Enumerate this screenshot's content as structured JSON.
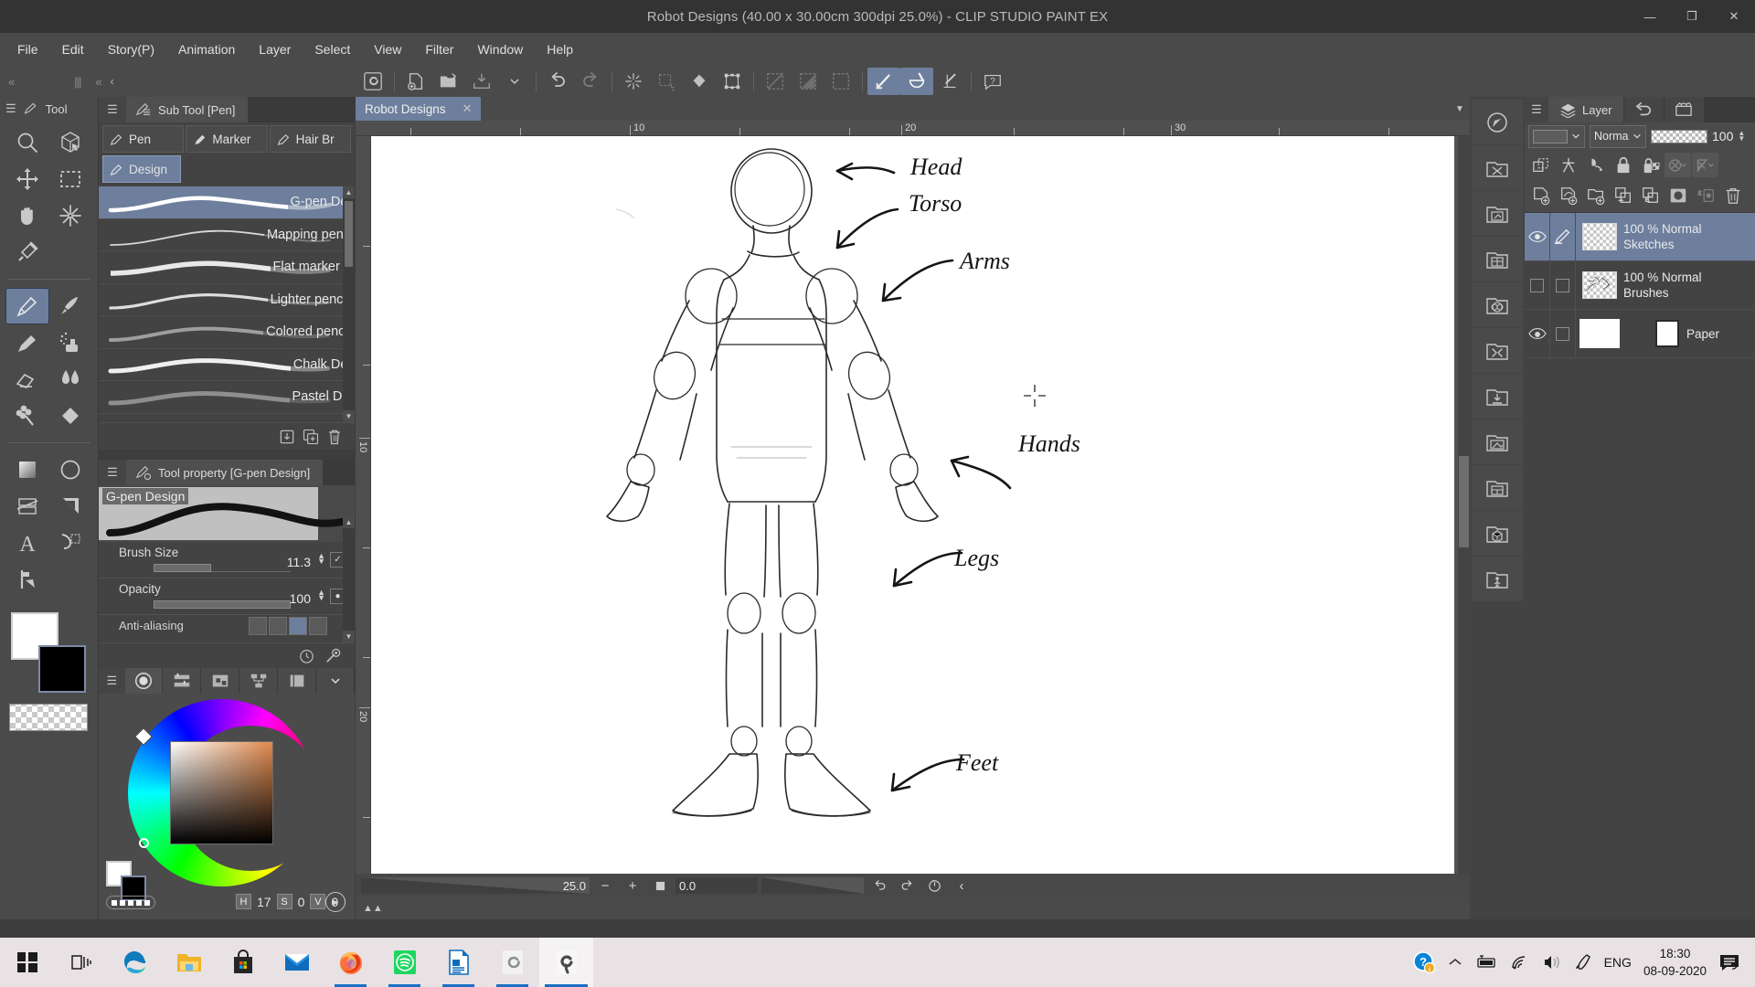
{
  "window": {
    "title": "Robot Designs (40.00 x 30.00cm 300dpi 25.0%)  - CLIP STUDIO PAINT EX",
    "minimize": "—",
    "maximize": "❐",
    "close": "✕"
  },
  "menu": {
    "items": [
      {
        "label": "File"
      },
      {
        "label": "Edit"
      },
      {
        "label": "Story(P)"
      },
      {
        "label": "Animation"
      },
      {
        "label": "Layer"
      },
      {
        "label": "Select"
      },
      {
        "label": "View"
      },
      {
        "label": "Filter"
      },
      {
        "label": "Window"
      },
      {
        "label": "Help"
      }
    ]
  },
  "command_bar": {
    "buttons": [
      {
        "name": "clip-studio-logo-button",
        "icon": "spiral-icon"
      },
      {
        "name": "new-document-button",
        "icon": "new-doc-icon"
      },
      {
        "name": "open-file-button",
        "icon": "open-folder-icon"
      },
      {
        "name": "save-button",
        "icon": "save-icon"
      },
      {
        "name": "save-dropdown-button",
        "icon": "chevron-down-icon"
      },
      {
        "name": "undo-button",
        "icon": "undo-arrow-icon"
      },
      {
        "name": "redo-button",
        "icon": "redo-arrow-icon"
      },
      {
        "name": "clear-button",
        "icon": "sparkle-clear-icon"
      },
      {
        "name": "fill-selection-button",
        "icon": "dashed-fill-icon"
      },
      {
        "name": "fill-button",
        "icon": "paint-drop-icon"
      },
      {
        "name": "transform-button",
        "icon": "transform-box-icon"
      },
      {
        "name": "deselect-button",
        "icon": "deselect-icon"
      },
      {
        "name": "invert-selection-button",
        "icon": "invert-selection-icon"
      },
      {
        "name": "select-all-button",
        "icon": "select-all-icon"
      },
      {
        "name": "snap-ruler-button",
        "icon": "snap-ruler-icon"
      },
      {
        "name": "snap-special-ruler-button",
        "icon": "snap-special-ruler-icon"
      },
      {
        "name": "snap-grid-button",
        "icon": "snap-grid-icon"
      },
      {
        "name": "help-button",
        "icon": "question-balloon-icon"
      }
    ]
  },
  "tool_palette": {
    "title": "Tool",
    "tools": [
      {
        "name": "zoom-tool",
        "icon": "magnifier-icon"
      },
      {
        "name": "rotate-3d-tool",
        "icon": "cube-cursor-icon"
      },
      {
        "name": "move-tool",
        "icon": "four-arrows-icon"
      },
      {
        "name": "operation-tool",
        "icon": "dashed-rect-icon"
      },
      {
        "name": "hand-tool",
        "icon": "hand-icon"
      },
      {
        "name": "auto-select-tool",
        "icon": "magic-wand-star-icon"
      },
      {
        "name": "eyedropper-tool",
        "icon": "eyedropper-icon"
      },
      {
        "name": "pen-tool",
        "icon": "pen-nib-icon"
      },
      {
        "name": "brush-tool",
        "icon": "brush-icon"
      },
      {
        "name": "pencil-tool",
        "icon": "pencil-icon"
      },
      {
        "name": "airbrush-tool",
        "icon": "airbrush-icon"
      },
      {
        "name": "eraser-tool",
        "icon": "eraser-icon"
      },
      {
        "name": "blend-tool",
        "icon": "blend-drops-icon"
      },
      {
        "name": "decoration-tool",
        "icon": "flower-decoration-icon"
      },
      {
        "name": "fill-tool",
        "icon": "paint-bucket-icon"
      },
      {
        "name": "gradient-tool",
        "icon": "gradient-square-icon"
      },
      {
        "name": "ellipse-tool",
        "icon": "circle-icon"
      },
      {
        "name": "frame-border-tool",
        "icon": "frame-border-icon"
      },
      {
        "name": "ruler-tool",
        "icon": "ruler-triangle-icon"
      },
      {
        "name": "text-tool",
        "icon": "letter-a-icon"
      },
      {
        "name": "balloon-tool",
        "icon": "speech-tail-icon"
      },
      {
        "name": "correct-line-tool",
        "icon": "correct-line-icon"
      }
    ],
    "active_tool": "pen-tool"
  },
  "sub_tool": {
    "tab_label": "Sub Tool [Pen]",
    "categories_row1": [
      {
        "label": "Pen",
        "selected": false
      },
      {
        "label": "Marker",
        "selected": false
      },
      {
        "label": "Hair Br",
        "selected": false
      }
    ],
    "categories_row2": [
      {
        "label": "Design",
        "selected": true
      }
    ],
    "items": [
      {
        "label": "G-pen Design",
        "selected": true
      },
      {
        "label": "Mapping pen Design",
        "selected": false
      },
      {
        "label": "Flat marker Design",
        "selected": false
      },
      {
        "label": "Lighter pencil Design",
        "selected": false
      },
      {
        "label": "Colored pencil Design",
        "selected": false
      },
      {
        "label": "Chalk Design",
        "selected": false
      },
      {
        "label": "Pastel Design",
        "selected": false
      }
    ],
    "footer_buttons": [
      {
        "name": "import-sub-tool-button",
        "icon": "download-box-icon"
      },
      {
        "name": "duplicate-sub-tool-button",
        "icon": "copy-plus-icon"
      },
      {
        "name": "delete-sub-tool-button",
        "icon": "trash-icon"
      }
    ]
  },
  "tool_property": {
    "tab_label": "Tool property [G-pen Design]",
    "preview_name": "G-pen Design",
    "properties": [
      {
        "label": "Brush Size",
        "value": "11.3",
        "fill_percent": 42
      },
      {
        "label": "Opacity",
        "value": "100",
        "fill_percent": 100
      },
      {
        "label": "Anti-aliasing",
        "value": ""
      }
    ],
    "footer_buttons": [
      {
        "name": "brush-timing-button",
        "icon": "clock-icon"
      },
      {
        "name": "sub-tool-detail-button",
        "icon": "wrench-icon"
      }
    ]
  },
  "color_panel": {
    "tabs": [
      {
        "name": "color-wheel-tab",
        "icon": "color-circle-icon",
        "selected": true
      },
      {
        "name": "color-slider-tab",
        "icon": "sliders-icon",
        "selected": false
      },
      {
        "name": "color-set-tab",
        "icon": "color-set-icon",
        "selected": false
      },
      {
        "name": "color-history-tab",
        "icon": "color-node-icon",
        "selected": false
      },
      {
        "name": "intermediate-color-tab",
        "icon": "book-icon",
        "selected": false
      },
      {
        "name": "color-more-tab",
        "icon": "chevron-down-icon",
        "selected": false
      }
    ],
    "hsv": {
      "h_key": "H",
      "h": "17",
      "s_key": "S",
      "s": "0",
      "v_key": "V",
      "v": "0"
    },
    "approx_color": "#e08a4d"
  },
  "canvas": {
    "tab_label": "Robot Designs",
    "tab_close": "✕",
    "ruler_h_numbers": [
      "10",
      "20",
      "30"
    ],
    "ruler_v_numbers": [
      "10",
      "20"
    ],
    "annotations": [
      {
        "label": "Head"
      },
      {
        "label": "Torso"
      },
      {
        "label": "Arms"
      },
      {
        "label": "Hands"
      },
      {
        "label": "Legs"
      },
      {
        "label": "Feet"
      }
    ]
  },
  "status_bar": {
    "zoom_value": "25.0",
    "zoom_out": "−",
    "zoom_in": "+",
    "fit_icon": "square-icon",
    "rotation_value": "0.0",
    "rotate_left": "undo-arrow-icon",
    "rotate_right": "redo-arrow-icon",
    "reset_rotation": "reset-rotate-icon",
    "collapse": "‹"
  },
  "right_icon_column": [
    {
      "name": "navigator-button",
      "icon": "navigator-icon"
    },
    {
      "name": "quick-access-button",
      "icon": "scissors-folder-icon"
    },
    {
      "name": "material-image-button",
      "icon": "image-folder-icon"
    },
    {
      "name": "material-layout-button",
      "icon": "layout-folder-icon"
    },
    {
      "name": "material-pattern-button",
      "icon": "pattern-folder-icon"
    },
    {
      "name": "material-effect-button",
      "icon": "effect-folder-icon"
    },
    {
      "name": "material-download-button",
      "icon": "download-folder-icon"
    },
    {
      "name": "material-picture-button",
      "icon": "picture-folder-icon"
    },
    {
      "name": "material-frame-button",
      "icon": "frame-folder-icon"
    },
    {
      "name": "material-3d-button",
      "icon": "cube-folder-icon"
    },
    {
      "name": "material-pose-button",
      "icon": "person-folder-icon"
    }
  ],
  "layer_panel": {
    "tabs": [
      {
        "label": "Layer",
        "icon": "layers-stack-icon",
        "selected": true
      },
      {
        "label": "",
        "icon": "history-undo-icon",
        "selected": false
      },
      {
        "label": "",
        "icon": "animation-film-icon",
        "selected": false
      }
    ],
    "blend": {
      "layer_color_value": "",
      "mode_value": "Normal",
      "opacity_value": "100"
    },
    "toolbar_row1": [
      {
        "name": "clip-to-layer-below-button",
        "icon": "clip-below-icon"
      },
      {
        "name": "set-as-reference-layer-button",
        "icon": "reference-layer-icon"
      },
      {
        "name": "set-as-draft-layer-button",
        "icon": "draft-layer-icon"
      },
      {
        "name": "lock-layer-button",
        "icon": "lock-icon"
      },
      {
        "name": "lock-transparent-pixels-button",
        "icon": "lock-transparent-icon"
      },
      {
        "name": "mask-disable-button",
        "icon": "mask-disable-icon"
      },
      {
        "name": "ruler-disable-button",
        "icon": "ruler-disable-icon"
      }
    ],
    "toolbar_row2": [
      {
        "name": "new-raster-layer-button",
        "icon": "new-raster-layer-icon"
      },
      {
        "name": "new-vector-layer-button",
        "icon": "new-vector-layer-icon"
      },
      {
        "name": "new-layer-folder-button",
        "icon": "new-folder-icon"
      },
      {
        "name": "transfer-down-button",
        "icon": "transfer-down-icon"
      },
      {
        "name": "combine-down-button",
        "icon": "combine-down-icon"
      },
      {
        "name": "create-mask-button",
        "icon": "create-mask-icon"
      },
      {
        "name": "layer-property-button",
        "icon": "layer-property-icon"
      },
      {
        "name": "delete-layer-button",
        "icon": "trash-icon"
      }
    ],
    "layers": [
      {
        "name": "Sketches",
        "info": "100 % Normal",
        "visible": true,
        "selected": true,
        "has_pen": true,
        "thumb": "checker"
      },
      {
        "name": "Brushes",
        "info": "100 % Normal",
        "visible": false,
        "selected": false,
        "has_pen": false,
        "thumb": "checker-sketch"
      },
      {
        "name": "Paper",
        "info": "",
        "visible": true,
        "selected": false,
        "has_pen": false,
        "thumb": "white"
      }
    ]
  },
  "taskbar": {
    "items": [
      {
        "name": "start-button",
        "icon": "windows-logo-icon",
        "state": "idle"
      },
      {
        "name": "task-view-button",
        "icon": "task-view-icon",
        "state": "idle"
      },
      {
        "name": "microsoft-edge-button",
        "icon": "edge-icon",
        "state": "idle"
      },
      {
        "name": "file-explorer-button",
        "icon": "folder-icon",
        "state": "idle"
      },
      {
        "name": "microsoft-store-button",
        "icon": "store-bag-icon",
        "state": "idle"
      },
      {
        "name": "mail-button",
        "icon": "mail-envelope-icon",
        "state": "idle"
      },
      {
        "name": "firefox-button",
        "icon": "firefox-icon",
        "state": "running"
      },
      {
        "name": "spotify-button",
        "icon": "spotify-icon",
        "state": "running"
      },
      {
        "name": "libreoffice-button",
        "icon": "libreoffice-icon",
        "state": "running"
      },
      {
        "name": "clip-studio-button",
        "icon": "clip-studio-spiral-icon",
        "state": "running"
      },
      {
        "name": "clip-studio-paint-button",
        "icon": "clip-studio-paint-icon",
        "state": "active"
      }
    ],
    "tray": {
      "help_icon": "question-circle-icon",
      "show_hidden_icon": "chevron-up-icon",
      "battery_icon": "battery-charging-icon",
      "network_icon": "wifi-icon",
      "volume_icon": "speaker-icon",
      "pen_icon": "pen-icon",
      "language": "ENG",
      "time": "18:30",
      "date": "08-09-2020",
      "notifications_icon": "notification-icon"
    }
  }
}
